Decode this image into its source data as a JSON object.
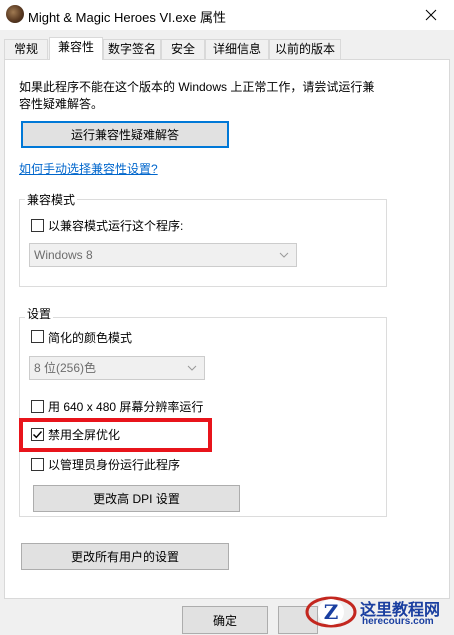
{
  "window": {
    "title": "Might & Magic Heroes VI.exe 属性",
    "app_icon": "game-icon",
    "close_icon": "close-icon"
  },
  "tabs": [
    {
      "label": "常规",
      "active": false
    },
    {
      "label": "兼容性",
      "active": true
    },
    {
      "label": "数字签名",
      "active": false
    },
    {
      "label": "安全",
      "active": false
    },
    {
      "label": "详细信息",
      "active": false
    },
    {
      "label": "以前的版本",
      "active": false
    }
  ],
  "intro": {
    "line1": "如果此程序不能在这个版本的 Windows 上正常工作，请尝试运行兼",
    "line2": "容性疑难解答。"
  },
  "troubleshooter_button": "运行兼容性疑难解答",
  "manual_link": "如何手动选择兼容性设置?",
  "compat_mode": {
    "group_label": "兼容模式",
    "checkbox_label": "以兼容模式运行这个程序:",
    "checked": false,
    "select_value": "Windows 8"
  },
  "settings": {
    "group_label": "设置",
    "reduced_color": {
      "label": "简化的颜色模式",
      "checked": false
    },
    "color_select": "8 位(256)色",
    "res_640": {
      "label": "用 640 x 480 屏幕分辨率运行",
      "checked": false
    },
    "disable_fullscreen_opt": {
      "label": "禁用全屏优化",
      "checked": true
    },
    "run_as_admin": {
      "label": "以管理员身份运行此程序",
      "checked": false
    },
    "dpi_button": "更改高 DPI 设置"
  },
  "all_users_button": "更改所有用户的设置",
  "footer": {
    "ok_button": "确定"
  },
  "watermark": {
    "line1": "这里教程网",
    "line2": "herecours.com"
  },
  "colors": {
    "highlight": "#e8141b",
    "focus": "#0078d7",
    "link": "#0066cc"
  }
}
